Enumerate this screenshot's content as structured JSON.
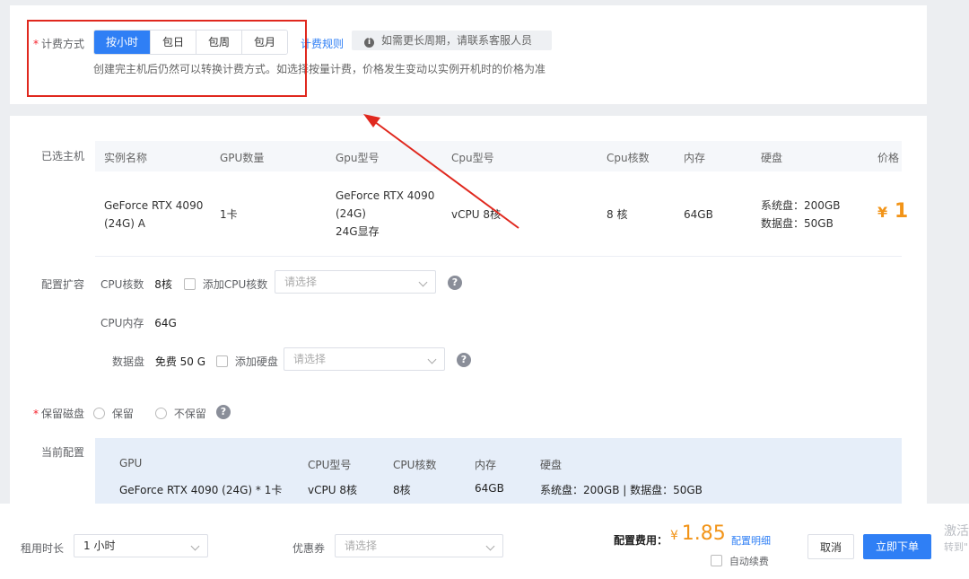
{
  "billing": {
    "required_mark": "*",
    "label": "计费方式",
    "options": [
      "按小时",
      "包日",
      "包周",
      "包月"
    ],
    "rules_link": "计费规则",
    "tip_icon": "info-icon",
    "tip": "如需更长周期，请联系客服人员",
    "note": "创建完主机后仍然可以转换计费方式。如选择按量计费，价格发生变动以实例开机时的价格为准"
  },
  "selected_host": {
    "label": "已选主机",
    "columns": [
      "实例名称",
      "GPU数量",
      "Gpu型号",
      "Cpu型号",
      "Cpu核数",
      "内存",
      "硬盘",
      "价格"
    ],
    "row": {
      "name_line1": "GeForce RTX 4090",
      "name_line2": "(24G) A",
      "gpu_count": "1卡",
      "gpu_model_line1": "GeForce RTX 4090",
      "gpu_model_line2": "(24G)",
      "gpu_model_line3": "24G显存",
      "cpu_model": "vCPU 8核",
      "cpu_cores": "8 核",
      "memory": "64GB",
      "disk_line1": "系统盘：200GB",
      "disk_line2": "数据盘：50GB",
      "price_symbol": "¥",
      "price_value": "1"
    }
  },
  "config_expand": {
    "label": "配置扩容",
    "cpu_cores_label": "CPU核数",
    "cpu_cores_value": "8核",
    "add_cpu_label": "添加CPU核数",
    "cpu_select_placeholder": "请选择",
    "cpu_memory_label": "CPU内存",
    "cpu_memory_value": "64G",
    "data_disk_label": "数据盘",
    "data_disk_value": "免费 50 G",
    "add_disk_label": "添加硬盘",
    "disk_select_placeholder": "请选择",
    "help_icon": "?"
  },
  "keep_disk": {
    "required_mark": "*",
    "label": "保留磁盘",
    "options": [
      "保留",
      "不保留"
    ],
    "help_icon": "?"
  },
  "current_config": {
    "label": "当前配置",
    "columns": [
      "GPU",
      "CPU型号",
      "CPU核数",
      "内存",
      "硬盘"
    ],
    "values": [
      "GeForce RTX 4090 (24G) * 1卡",
      "vCPU 8核",
      "8核",
      "64GB",
      "系统盘：200GB | 数据盘：50GB"
    ]
  },
  "footer": {
    "duration_label": "租用时长",
    "duration_value": "1 小时",
    "coupon_label": "优惠券",
    "coupon_placeholder": "请选择",
    "fee_label": "配置费用：",
    "fee_symbol": "¥",
    "fee_value": "1.85",
    "fee_detail_link": "配置明细",
    "auto_renew_label": "自动续费",
    "cancel_button": "取消",
    "order_button": "立即下单",
    "watermark_line1": "激活",
    "watermark_line2": "转到\""
  },
  "colors": {
    "primary": "#2f7ff5",
    "price": "#f29418",
    "highlight_box": "#e0281e",
    "required": "#f5222d"
  }
}
